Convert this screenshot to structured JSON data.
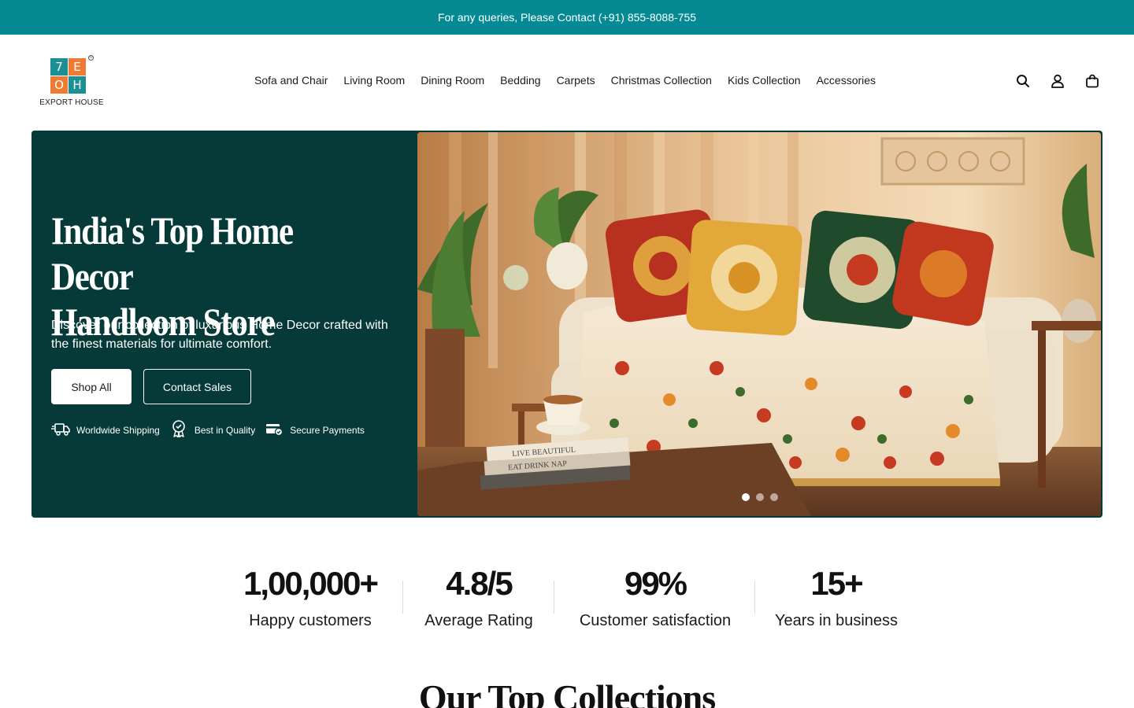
{
  "announcement": {
    "text": "For any queries, Please Contact (+91) 855-8088-755"
  },
  "brand": {
    "logo_letters": [
      "7",
      "E",
      "O",
      "H"
    ],
    "registered_mark": "®",
    "name": "EXPORT HOUSE",
    "colors": {
      "teal": "#1a8f96",
      "orange": "#ef7a32"
    }
  },
  "nav": {
    "items": [
      {
        "label": "Sofa and Chair"
      },
      {
        "label": "Living Room"
      },
      {
        "label": "Dining Room"
      },
      {
        "label": "Bedding"
      },
      {
        "label": "Carpets"
      },
      {
        "label": "Christmas Collection"
      },
      {
        "label": "Kids Collection"
      },
      {
        "label": "Accessories"
      }
    ]
  },
  "header_icons": [
    "search-icon",
    "account-icon",
    "cart-icon"
  ],
  "hero": {
    "title_line1": "India's Top Home Decor",
    "title_line2": "Handloom Store",
    "subtitle": "Discover our collection of luxurious Home Decor crafted with the finest materials for ultimate comfort.",
    "shop_button": "Shop All",
    "contact_button": "Contact Sales",
    "badges": [
      {
        "icon": "truck-icon",
        "label": "Worldwide Shipping"
      },
      {
        "icon": "award-icon",
        "label": "Best in Quality"
      },
      {
        "icon": "card-icon",
        "label": "Secure Payments"
      }
    ],
    "slider": {
      "slide_count": 3,
      "active_slide": 1
    },
    "image_text": {
      "book1": "LIVE BEAUTIFUL",
      "book3": "EAT DRINK NAP"
    },
    "colors": {
      "panel": "#053a38",
      "announcement": "#058a94"
    }
  },
  "stats": [
    {
      "value": "1,00,000+",
      "label": "Happy customers"
    },
    {
      "value": "4.8/5",
      "label": "Average Rating"
    },
    {
      "value": "99%",
      "label": "Customer satisfaction"
    },
    {
      "value": "15+",
      "label": "Years in business"
    }
  ],
  "collections": {
    "title": "Our Top Collections"
  }
}
